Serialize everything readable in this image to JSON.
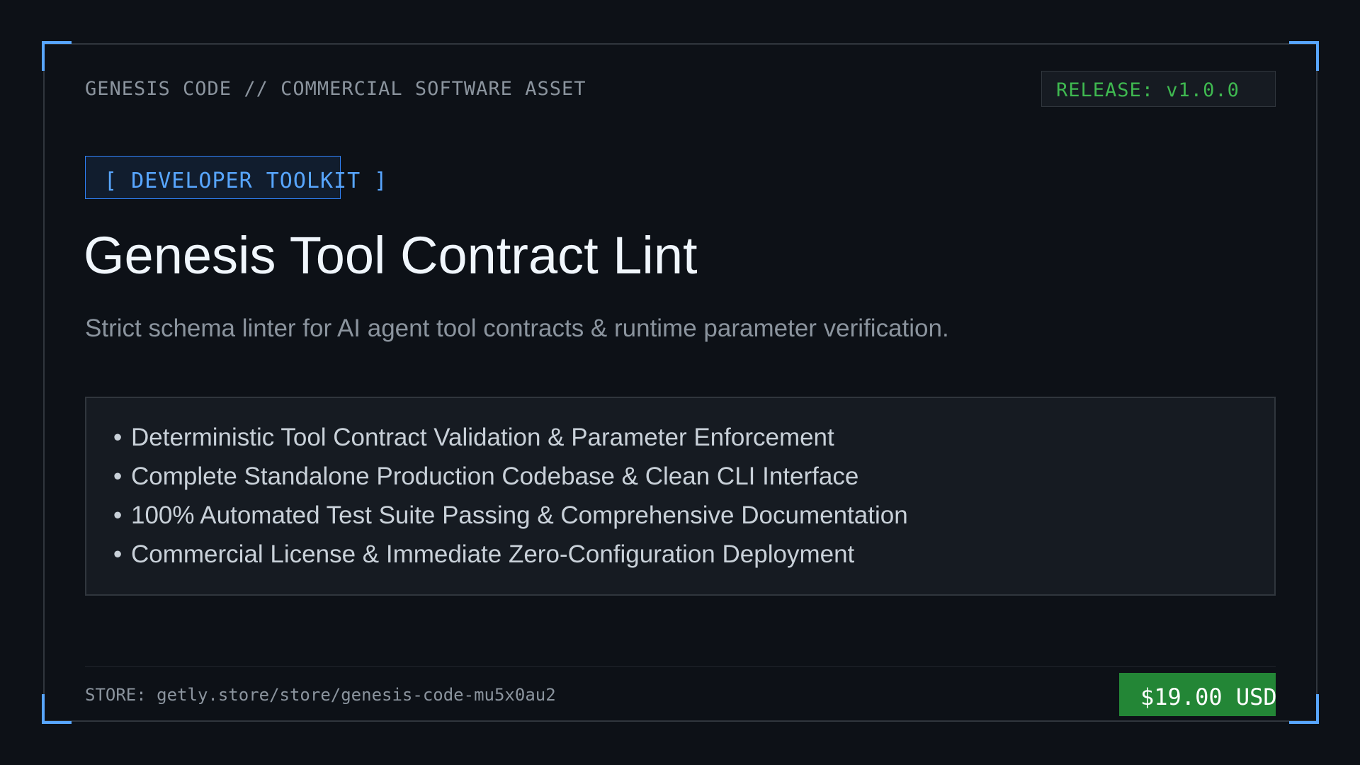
{
  "header": {
    "label": "GENESIS CODE // COMMERCIAL SOFTWARE ASSET",
    "release": "RELEASE: v1.0.0"
  },
  "tag": "[ DEVELOPER TOOLKIT ]",
  "product": {
    "title": "Genesis Tool Contract Lint",
    "subtitle": "Strict schema linter for AI agent tool contracts & runtime parameter verification."
  },
  "features": [
    "Deterministic Tool Contract Validation & Parameter Enforcement",
    "Complete Standalone Production Codebase & Clean CLI Interface",
    "100% Automated Test Suite Passing & Comprehensive Documentation",
    "Commercial License & Immediate Zero-Configuration Deployment"
  ],
  "bullet_glyph": "•",
  "footer": {
    "store": "STORE: getly.store/store/genesis-code-mu5x0au2",
    "price": "$19.00 USD"
  },
  "colors": {
    "background": "#0d1117",
    "accent_blue": "#58a6ff",
    "release_green": "#3fb950",
    "price_green": "#238636"
  }
}
